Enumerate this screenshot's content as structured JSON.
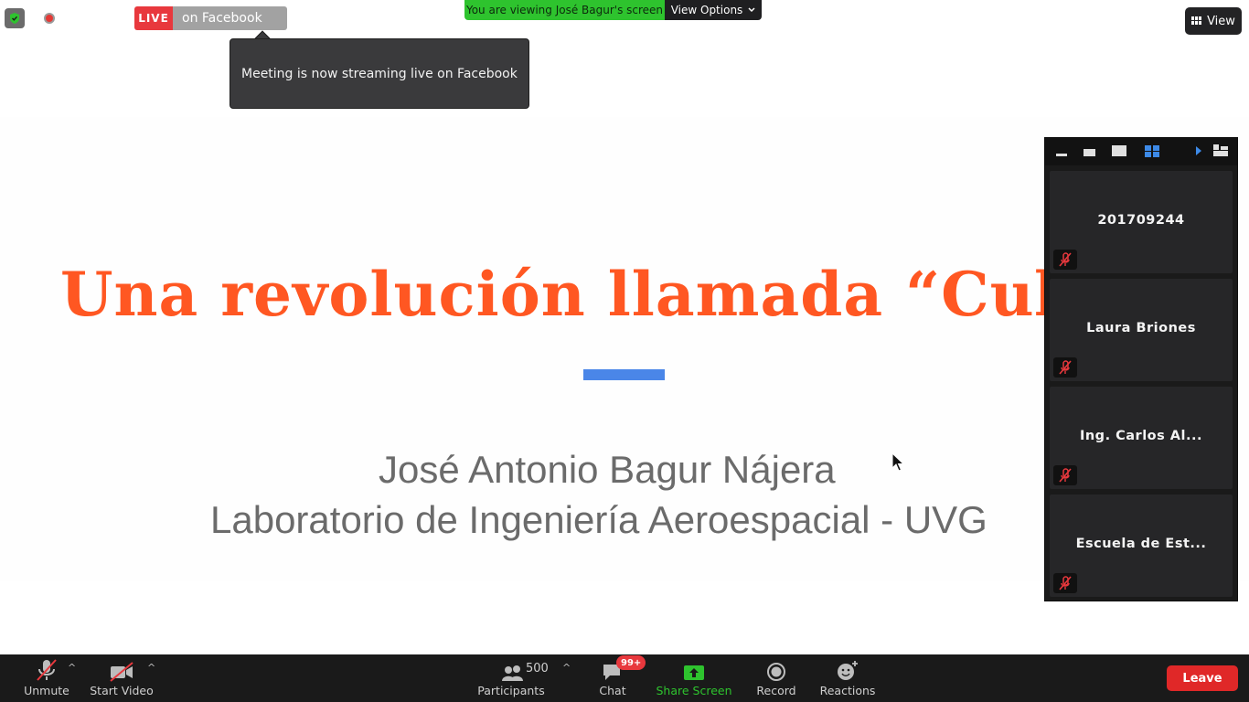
{
  "top_bar": {
    "live_label": "LIVE",
    "live_platform": "on Facebook",
    "viewing_banner": "You are viewing José Bagur's screen",
    "view_options_label": "View Options",
    "view_button_label": "View"
  },
  "tooltip": {
    "message": "Meeting is now streaming live on Facebook"
  },
  "slide": {
    "title": "Una revolución llamada “Cube",
    "author": "José Antonio Bagur Nájera",
    "lab": "Laboratorio de Ingeniería Aeroespacial - UVG"
  },
  "participants_panel": {
    "tiles": [
      {
        "name": "201709244",
        "muted": true
      },
      {
        "name": "Laura Briones",
        "muted": true
      },
      {
        "name": "Ing. Carlos Al...",
        "muted": true
      },
      {
        "name": "Escuela de Est...",
        "muted": true
      }
    ]
  },
  "toolbar": {
    "unmute_label": "Unmute",
    "start_video_label": "Start Video",
    "participants_label": "Participants",
    "participants_count": "500",
    "chat_label": "Chat",
    "chat_badge": "99+",
    "share_screen_label": "Share Screen",
    "record_label": "Record",
    "reactions_label": "Reactions",
    "leave_label": "Leave"
  },
  "colors": {
    "live_red": "#e8383d",
    "viewing_green": "#2ec32e",
    "slide_title": "#ff5722",
    "slide_accent": "#4a86e8",
    "leave_red": "#e02828"
  }
}
